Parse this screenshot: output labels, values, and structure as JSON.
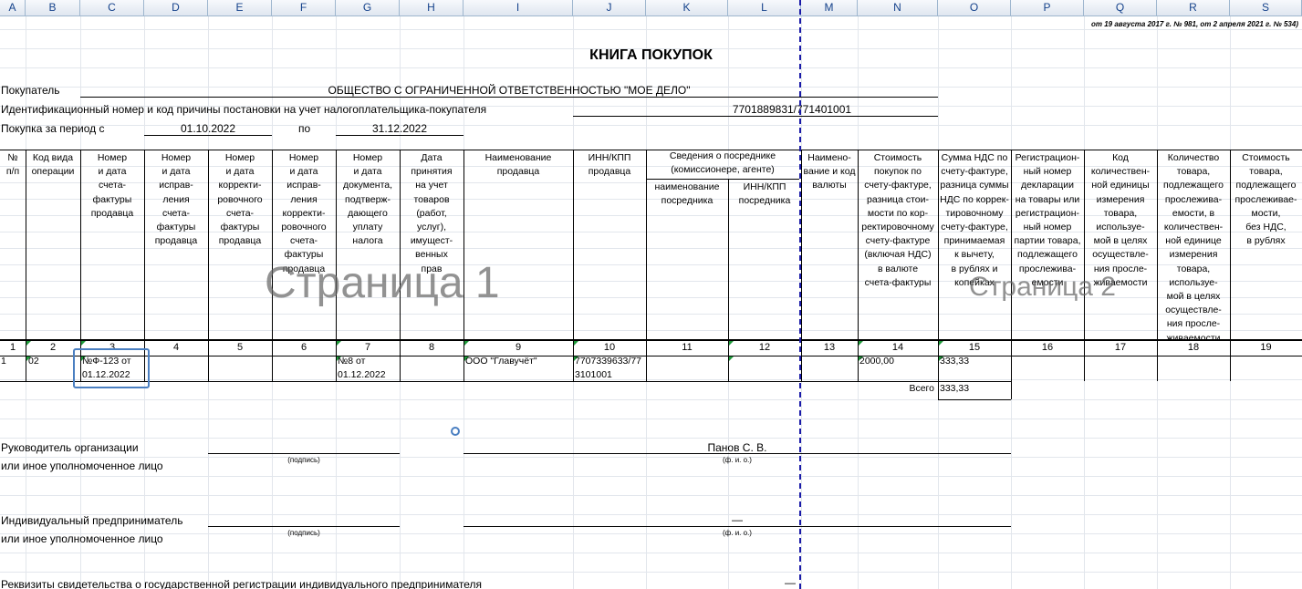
{
  "columns": [
    "A",
    "B",
    "C",
    "D",
    "E",
    "F",
    "G",
    "H",
    "I",
    "J",
    "K",
    "L",
    "M",
    "N",
    "O",
    "P",
    "Q",
    "R",
    "S"
  ],
  "top_note": "от 19 августа 2017 г. № 981, от 2 апреля 2021 г. № 534)",
  "title": "КНИГА ПОКУПОК",
  "buyer": {
    "label": "Покупатель",
    "value": "ОБЩЕСТВО С ОГРАНИЧЕННОЙ ОТВЕТСТВЕННОСТЬЮ \"МОЕ ДЕЛО\""
  },
  "inn": {
    "label": "Идентификационный номер и код причины постановки на учет налогоплательщика-покупателя",
    "value": "7701889831/771401001"
  },
  "period": {
    "label": "Покупка за период с",
    "from": "01.10.2022",
    "to_label": "по",
    "to": "31.12.2022"
  },
  "table_headers": [
    "№\nп/п",
    "Код вида\nоперации",
    "Номер\nи дата\nсчета-\nфактуры\nпродавца",
    "Номер\nи дата\nисправ-\nления\nсчета-\nфактуры\nпродавца",
    "Номер\nи дата\nкорректи-\nровочного\nсчета-\nфактуры\nпродавца",
    "Номер\nи дата\nисправ-\nления\nкорректи-\nровочного\nсчета-\nфактуры\nпродавца",
    "Номер\nи дата\nдокумента,\nподтверж-\nдающего\nуплату\nналога",
    "Дата\nпринятия\nна учет\nтоваров\n(работ,\nуслуг),\nимущест-\nвенных\nправ",
    "Наименование\nпродавца",
    "ИНН/КПП\nпродавца",
    "наименование\nпосредника",
    "ИНН/КПП\nпосредника",
    "Наимено-\nвание и код\nвалюты",
    "Стоимость\nпокупок по\nсчету-фактуре,\nразница стои-\nмости по кор-\nректировочному\nсчету-фактуре\n(включая НДС)\nв валюте\nсчета-фактуры",
    "Сумма НДС по\nсчету-фактуре,\nразница суммы\nНДС по коррек-\nтировочному\nсчету-фактуре,\nпринимаемая\nк вычету,\nв рублях и\nкопейках",
    "Регистрацион-\nный номер\nдекларации\nна товары или\nрегистрацион-\nный номер\nпартии товара,\nподлежащего\nпрослежива-\nемости",
    "Код\nколичествен-\nной единицы\nизмерения\nтовара,\nиспользуе-\nмой в целях\nосуществле-\nния просле-\nживаемости",
    "Количество\nтовара,\nподлежащего\nпрослежива-\nемости, в\nколичествен-\nной единице\nизмерения\nтовара,\nиспользуе-\nмой в целях\nосуществле-\nния просле-\nживаемости",
    "Стоимость\nтовара,\nподлежащего\nпрослеживае-\nмости,\nбез НДС,\nв рублях"
  ],
  "intermediary_header": "Сведения о посреднике\n(комиссионере, агенте)",
  "column_numbers": [
    "1",
    "2",
    "3",
    "4",
    "5",
    "6",
    "7",
    "8",
    "9",
    "10",
    "11",
    "12",
    "13",
    "14",
    "15",
    "16",
    "17",
    "18",
    "19"
  ],
  "row": {
    "n": "1",
    "op_code": "02",
    "invoice": "№Ф-123 от\n01.12.2022",
    "payment_doc": "№8 от\n01.12.2022",
    "seller": "ООО \"Главучёт\"",
    "seller_inn": "7707339633/77\n3101001",
    "cost": "2000,00",
    "vat": "333,33"
  },
  "total": {
    "label": "Всего",
    "value": "333,33"
  },
  "watermarks": {
    "page1": "Страница 1",
    "page2": "Страница 2"
  },
  "signatures": {
    "head_line1": "Руководитель организации",
    "head_line2": "или иное уполномоченное лицо",
    "head_name": "Панов С. В.",
    "sign_caption": "(подпись)",
    "fio_caption": "(ф. и. о.)",
    "ip_line1": "Индивидуальный предприниматель",
    "ip_line2": " или иное уполномоченное лицо",
    "ip_name": "—",
    "requisites": "Реквизиты свидетельства о государственной регистрации индивидуального предпринимателя",
    "requisites_value": "—"
  },
  "colors": {
    "page_break": "#1a1aa8",
    "selection": "#4a7fc1",
    "header_text": "#15428b"
  }
}
